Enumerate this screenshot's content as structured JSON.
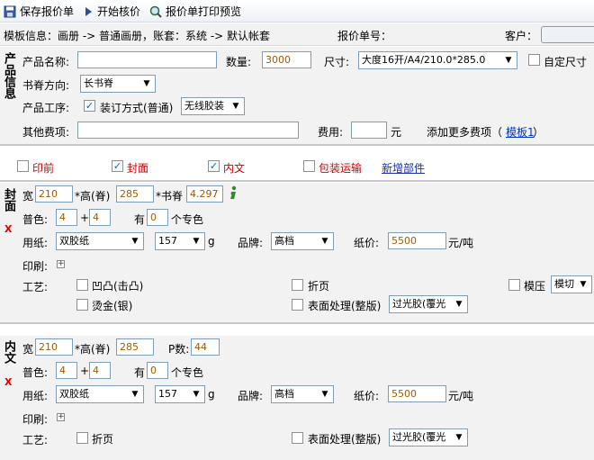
{
  "toolbar": {
    "save": "保存报价单",
    "start": "开始核价",
    "preview": "报价单打印预览"
  },
  "info": {
    "template_label": "模板信息：画册 -> 普通画册，账套：系统 -> 默认帐套",
    "quote_no_label": "报价单号：",
    "customer_label": "客户："
  },
  "product": {
    "section_label": "产品信息",
    "name_label": "产品名称:",
    "name_value": "",
    "qty_label": "数量:",
    "qty_value": "3000",
    "size_label": "尺寸:",
    "size_value": "大度16开/A4/210.0*285.0",
    "custom_size_label": "自定尺寸",
    "spine_label": "书脊方向:",
    "spine_value": "长书脊",
    "process_label": "产品工序:",
    "binding_label": "装订方式(普通)",
    "binding_value": "无线胶装",
    "other_fee_label": "其他费项:",
    "other_fee_value": "",
    "fee_label": "费用:",
    "fee_value": "",
    "yuan": "元",
    "add_more_label": "添加更多费项（",
    "template_link": "模板1",
    "close_paren": "）"
  },
  "parts": {
    "print_label": "印前",
    "cover_label": "封面",
    "inner_label": "内文",
    "packing_label": "包装运输",
    "add_part_link": "新增部件"
  },
  "cover": {
    "section_label": "封面",
    "x_mark": "X",
    "width_label": "宽",
    "width_value": "210",
    "height_label": "*高(脊)",
    "height_value": "285",
    "spine_label": "*书脊",
    "spine_value": "4.297",
    "color_label": "普色:",
    "color_a": "4",
    "plus": "+",
    "color_b": "4",
    "has_label": "有",
    "spot_value": "0",
    "spot_label": "个专色",
    "paper_label": "用纸:",
    "paper_value": "双胶纸",
    "weight_value": "157",
    "g_unit": "g",
    "brand_label": "品牌:",
    "brand_value": "高档",
    "price_label": "纸价:",
    "price_value": "5500",
    "price_unit": "元/吨",
    "print_label": "印刷:",
    "craft_label": "工艺:",
    "emboss_label": "凹凸(击凸)",
    "fold_label": "折页",
    "die_label": "模压",
    "die_value": "模切",
    "foil_label": "烫金(银)",
    "surface_label": "表面处理(整版)",
    "surface_value": "过光胶(覆光"
  },
  "inner": {
    "section_label": "内文",
    "x_mark": "X",
    "width_label": "宽",
    "width_value": "210",
    "height_label": "*高(脊)",
    "height_value": "285",
    "pages_label": "P数:",
    "pages_value": "44",
    "color_label": "普色:",
    "color_a": "4",
    "plus": "+",
    "color_b": "4",
    "has_label": "有",
    "spot_value": "0",
    "spot_label": "个专色",
    "paper_label": "用纸:",
    "paper_value": "双胶纸",
    "weight_value": "157",
    "g_unit": "g",
    "brand_label": "品牌:",
    "brand_value": "高档",
    "price_label": "纸价:",
    "price_value": "5500",
    "price_unit": "元/吨",
    "print_label": "印刷:",
    "craft_label": "工艺:",
    "fold_label": "折页",
    "surface_label": "表面处理(整版)",
    "surface_value": "过光胶(覆光"
  },
  "icons": {
    "save": "floppy-disk-icon",
    "start": "play-arrow-icon",
    "preview": "magnifier-icon",
    "info": "info-icon",
    "dropdown": "chevron-down-icon",
    "expand": "plus-box-icon"
  },
  "colors": {
    "accent_link": "#0033cc",
    "red_label": "#cc0000",
    "input_value": "#a05a00",
    "panel_bg": "#f2f2f2"
  }
}
